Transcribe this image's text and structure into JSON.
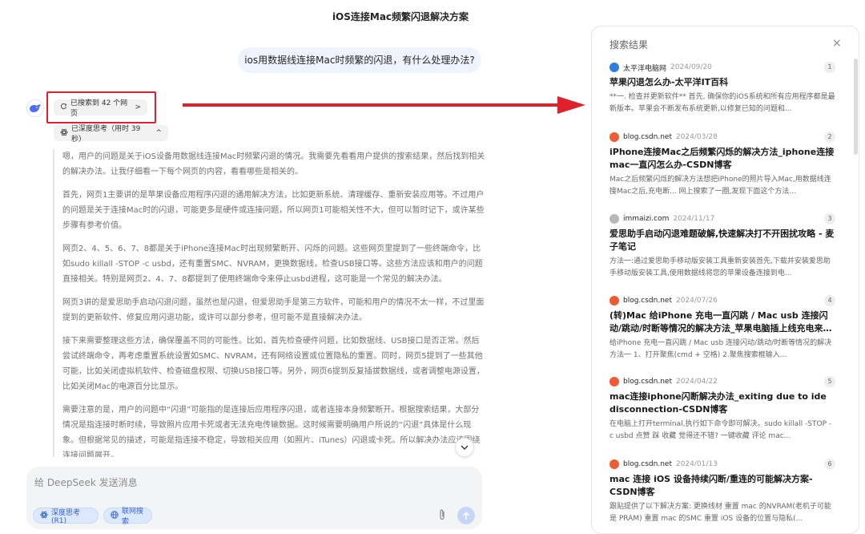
{
  "page_title": "iOS连接Mac频繁闪退解决方案",
  "user_message": "ios用数据线连接Mac时频繁的闪退，有什么处理办法?",
  "search_chip": {
    "label": "已搜索到 42 个网页",
    "chevron": ">"
  },
  "think_chip": {
    "label": "已深度思考（用时 39 秒）",
    "chevron": "^"
  },
  "reasoning": [
    "嗯，用户的问题是关于iOS设备用数据线连接Mac时频繁闪退的情况。我需要先看看用户提供的搜索结果，然后找到相关的解决办法。让我仔细看一下每个网页的内容，看看哪些是相关的。",
    "首先，网页1主要讲的是苹果设备应用程序闪退的通用解决方法，比如更新系统、清理缓存、重新安装应用等。不过用户的问题是关于连接Mac时的闪退，可能更多是硬件或连接问题，所以网页1可能相关性不大，但可以暂时记下，或许某些步骤有参考价值。",
    "网页2、4、5、6、7、8都是关于iPhone连接Mac时出现频繁断开、闪烁的问题。这些网页里提到了一些终端命令，比如sudo killall -STOP -c usbd，还有重置SMC、NVRAM，更换数据线，检查USB接口等。这些方法应该和用户的问题直接相关。特别是网页2、4、7、8都提到了使用终端命令来停止usbd进程，这可能是一个常见的解决办法。",
    "网页3讲的是爱思助手启动闪退问题，虽然也是闪退，但爱思助手是第三方软件，可能和用户的情况不太一样，不过里面提到的更新软件、修复应用闪退功能，或许可以部分参考，但可能不是直接解决办法。",
    "接下来需要整理这些方法，确保覆盖不同的可能性。比如，首先检查硬件问题，比如数据线、USB接口是否正常。然后尝试终端命令，再考虑重置系统设置如SMC、NVRAM，还有网络设置或位置隐私的重置。同时，网页5提到了一些其他可能，比如关闭虚拟机软件、检查磁盘权限、切换USB接口等。另外，网页6提到反复插拔数据线，或者调整电源设置，比如关闭Mac的电源百分比显示。",
    "需要注意的是，用户的问题中“闪退”可能指的是连接后应用程序闪退，或者连接本身频繁断开。根据搜索结果，大部分情况是指连接时断时续，导致照片应用卡死或者无法充电传输数据。这时候需要明确用户所说的“闪退”具体是什么现象。但根据常见的描述，可能是指连接不稳定，导致相关应用（如照片、iTunes）闪退或卡死。所以解决办法应该围绕连接问题展开。"
  ],
  "composer": {
    "placeholder": "给 DeepSeek 发送消息",
    "deep_think_label": "深度思考 (R1)",
    "web_search_label": "联网搜索"
  },
  "panel": {
    "title": "搜索结果",
    "close_symbol": "×",
    "results": [
      {
        "index": "1",
        "site": "太平洋电脑网",
        "date": "2024/09/20",
        "icon_color": "#2f7de1",
        "title": "苹果闪退怎么办-太平洋IT百科",
        "snippet": "**一. 检查并更新软件** 首先, 确保你的iOS系统和所有应用程序都是最新版本。苹果会不断发布系统更新,以修复已知的问题和..."
      },
      {
        "index": "2",
        "site": "blog.csdn.net",
        "date": "2024/03/28",
        "icon_color": "#f05a35",
        "title": "iPhone连接Mac之后频繁闪烁的解决方法_iphone连接mac一直闪怎么办-CSDN博客",
        "snippet": "Mac之后频繁闪烁的解决方法想把iPhone的照片导入Mac,用数据线连接Mac之后,充电断... 网上搜索了一圈,发现下面这个方法..."
      },
      {
        "index": "3",
        "site": "immaizi.com",
        "date": "2024/11/17",
        "icon_color": "#b8b8b8",
        "title": "爱思助手启动闪退难题破解,快速解决打不开困扰攻略 - 麦子笔记",
        "snippet": "方法一:通过爱思助手移动版安装工具重新安装首先,下载并安装爱思助手移动版安装工具,使用数据线将您的苹果设备连接到电..."
      },
      {
        "index": "4",
        "site": "blog.csdn.net",
        "date": "2024/07/26",
        "icon_color": "#f05a35",
        "title": "(转)Mac 给iPhone 充电一直闪跳 / Mac usb 连接闪动/跳动/时断等情况的解决方法_苹果电脑插上线充电来回跳-...",
        "snippet": "给iPhone 充电一直闪跳 / Mac usb 连接闪动/跳动/时断等情况的解决 方法一 1、打开聚焦(cmd + 空格) 2.聚焦搜索框输入..."
      },
      {
        "index": "5",
        "site": "blog.csdn.net",
        "date": "2024/04/22",
        "icon_color": "#f05a35",
        "title": "mac连接iphone闪断解决办法_exiting due to ide disconnection-CSDN博客",
        "snippet": "在电脑上打开terminal,执行如下命令即可解决。sudo killall -STOP -c usbd 点赞 踩 收藏 觉得还不错? 一键收藏 评论 mac..."
      },
      {
        "index": "6",
        "site": "blog.csdn.net",
        "date": "2024/01/13",
        "icon_color": "#f05a35",
        "title": "mac 连接 iOS 设备持续闪断/重连的可能解决方案-CSDN博客",
        "snippet": "跟贴提供了以下解决方案: 更换线材 重置 mac 的NVRAM(老机子可能是 PRAM) 重置 mac 的SMC 重置 iOS 设备的位置与隐私(..."
      }
    ]
  }
}
